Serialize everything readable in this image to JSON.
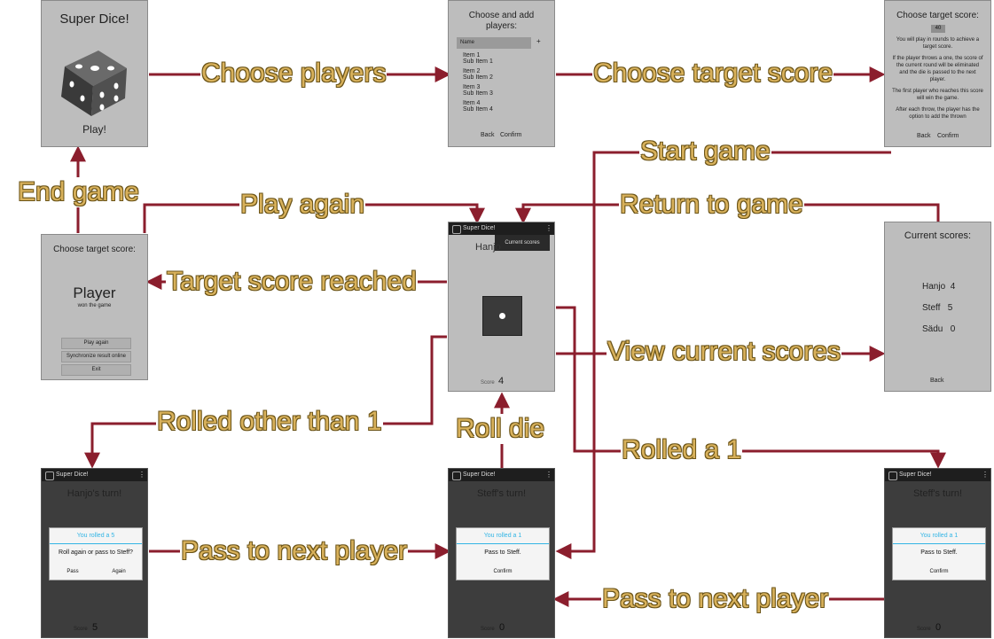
{
  "flow_labels": {
    "choose_players": "Choose players",
    "choose_target_score": "Choose target score",
    "start_game": "Start game",
    "end_game": "End game",
    "play_again": "Play again",
    "return_to_game": "Return to game",
    "target_score_reached": "Target score reached",
    "view_current_scores": "View current scores",
    "rolled_other_than_1": "Rolled other than 1",
    "roll_die": "Roll die",
    "rolled_a_1": "Rolled a 1",
    "pass_to_next_player_1": "Pass to next player",
    "pass_to_next_player_2": "Pass to next player"
  },
  "screen_start": {
    "title": "Super Dice!",
    "play_button": "Play!"
  },
  "screen_players": {
    "title": "Choose and add players:",
    "name_placeholder": "Name",
    "add_symbol": "+",
    "items": [
      {
        "item": "Item 1",
        "sub": "Sub Item 1"
      },
      {
        "item": "Item 2",
        "sub": "Sub Item 2"
      },
      {
        "item": "Item 3",
        "sub": "Sub Item 3"
      },
      {
        "item": "Item 4",
        "sub": "Sub Item 4"
      }
    ],
    "back": "Back",
    "confirm": "Confirm"
  },
  "screen_target": {
    "title": "Choose target score:",
    "value": "40",
    "p1": "You will play in rounds to achieve a target score.",
    "p2": "If the player throws a one, the score of the current round will be eliminated and the die is passed to the next player.",
    "p3": "The first player who reaches this score will win the game.",
    "p4": "After each throw, the player has the option to add the thrown",
    "back": "Back",
    "confirm": "Confirm"
  },
  "screen_winner": {
    "title": "Choose target score:",
    "player": "Player",
    "won": "won the game",
    "play_again": "Play again",
    "sync": "Synchronize result online",
    "exit": "Exit"
  },
  "screen_game": {
    "app_title": "Super Dice!",
    "menu_item": "Current scores",
    "heading": "Hanjo",
    "score_label": "Score",
    "score_value": "4"
  },
  "screen_scores": {
    "title": "Current scores:",
    "rows": [
      {
        "name": "Hanjo",
        "score": "4"
      },
      {
        "name": "Steff",
        "score": "5"
      },
      {
        "name": "Sädu",
        "score": "0"
      }
    ],
    "back": "Back"
  },
  "screen_hanjo": {
    "app_title": "Super Dice!",
    "heading": "Hanjo's turn!",
    "dialog_title": "You rolled a 5",
    "dialog_msg": "Roll again or pass to Steff?",
    "pass": "Pass",
    "again": "Again",
    "score_label": "Score",
    "score_value": "5"
  },
  "screen_steff_mid": {
    "app_title": "Super Dice!",
    "heading": "Steff's turn!",
    "dialog_title": "You rolled a 1",
    "dialog_msg": "Pass to Steff.",
    "confirm": "Confirm",
    "score_label": "Score",
    "score_value": "0"
  },
  "screen_steff_right": {
    "app_title": "Super Dice!",
    "heading": "Steff's turn!",
    "dialog_title": "You rolled a 1",
    "dialog_msg": "Pass to Steff.",
    "confirm": "Confirm",
    "score_label": "Score",
    "score_value": "0"
  },
  "colors": {
    "arrow": "#8b1e2d",
    "label": "#d8b15b",
    "screen_light": "#bdbdbd",
    "screen_dark": "#3d3d3d",
    "dialog_accent": "#33b5e5"
  }
}
